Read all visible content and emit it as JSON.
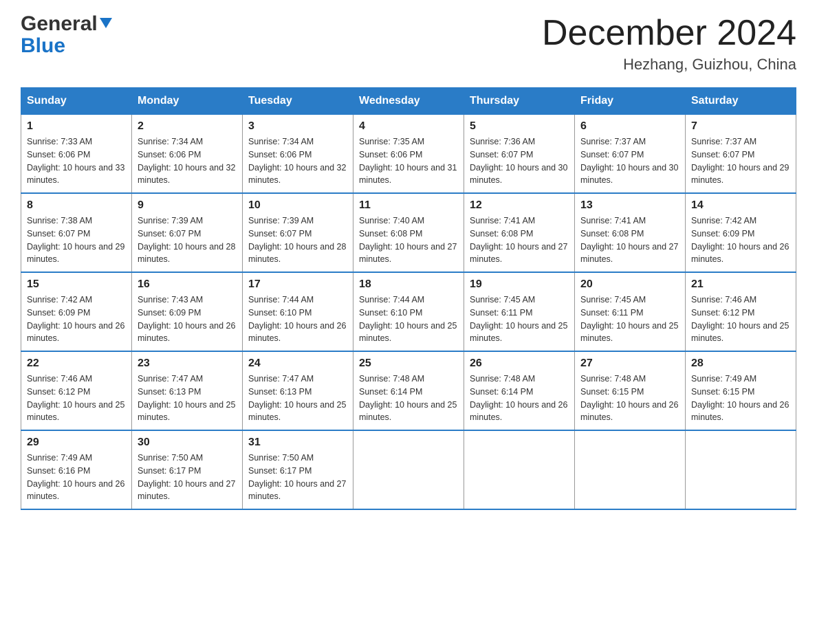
{
  "header": {
    "logo_general": "General",
    "logo_blue": "Blue",
    "month": "December 2024",
    "location": "Hezhang, Guizhou, China"
  },
  "weekdays": [
    "Sunday",
    "Monday",
    "Tuesday",
    "Wednesday",
    "Thursday",
    "Friday",
    "Saturday"
  ],
  "weeks": [
    [
      {
        "day": "1",
        "sunrise": "7:33 AM",
        "sunset": "6:06 PM",
        "daylight": "10 hours and 33 minutes."
      },
      {
        "day": "2",
        "sunrise": "7:34 AM",
        "sunset": "6:06 PM",
        "daylight": "10 hours and 32 minutes."
      },
      {
        "day": "3",
        "sunrise": "7:34 AM",
        "sunset": "6:06 PM",
        "daylight": "10 hours and 32 minutes."
      },
      {
        "day": "4",
        "sunrise": "7:35 AM",
        "sunset": "6:06 PM",
        "daylight": "10 hours and 31 minutes."
      },
      {
        "day": "5",
        "sunrise": "7:36 AM",
        "sunset": "6:07 PM",
        "daylight": "10 hours and 30 minutes."
      },
      {
        "day": "6",
        "sunrise": "7:37 AM",
        "sunset": "6:07 PM",
        "daylight": "10 hours and 30 minutes."
      },
      {
        "day": "7",
        "sunrise": "7:37 AM",
        "sunset": "6:07 PM",
        "daylight": "10 hours and 29 minutes."
      }
    ],
    [
      {
        "day": "8",
        "sunrise": "7:38 AM",
        "sunset": "6:07 PM",
        "daylight": "10 hours and 29 minutes."
      },
      {
        "day": "9",
        "sunrise": "7:39 AM",
        "sunset": "6:07 PM",
        "daylight": "10 hours and 28 minutes."
      },
      {
        "day": "10",
        "sunrise": "7:39 AM",
        "sunset": "6:07 PM",
        "daylight": "10 hours and 28 minutes."
      },
      {
        "day": "11",
        "sunrise": "7:40 AM",
        "sunset": "6:08 PM",
        "daylight": "10 hours and 27 minutes."
      },
      {
        "day": "12",
        "sunrise": "7:41 AM",
        "sunset": "6:08 PM",
        "daylight": "10 hours and 27 minutes."
      },
      {
        "day": "13",
        "sunrise": "7:41 AM",
        "sunset": "6:08 PM",
        "daylight": "10 hours and 27 minutes."
      },
      {
        "day": "14",
        "sunrise": "7:42 AM",
        "sunset": "6:09 PM",
        "daylight": "10 hours and 26 minutes."
      }
    ],
    [
      {
        "day": "15",
        "sunrise": "7:42 AM",
        "sunset": "6:09 PM",
        "daylight": "10 hours and 26 minutes."
      },
      {
        "day": "16",
        "sunrise": "7:43 AM",
        "sunset": "6:09 PM",
        "daylight": "10 hours and 26 minutes."
      },
      {
        "day": "17",
        "sunrise": "7:44 AM",
        "sunset": "6:10 PM",
        "daylight": "10 hours and 26 minutes."
      },
      {
        "day": "18",
        "sunrise": "7:44 AM",
        "sunset": "6:10 PM",
        "daylight": "10 hours and 25 minutes."
      },
      {
        "day": "19",
        "sunrise": "7:45 AM",
        "sunset": "6:11 PM",
        "daylight": "10 hours and 25 minutes."
      },
      {
        "day": "20",
        "sunrise": "7:45 AM",
        "sunset": "6:11 PM",
        "daylight": "10 hours and 25 minutes."
      },
      {
        "day": "21",
        "sunrise": "7:46 AM",
        "sunset": "6:12 PM",
        "daylight": "10 hours and 25 minutes."
      }
    ],
    [
      {
        "day": "22",
        "sunrise": "7:46 AM",
        "sunset": "6:12 PM",
        "daylight": "10 hours and 25 minutes."
      },
      {
        "day": "23",
        "sunrise": "7:47 AM",
        "sunset": "6:13 PM",
        "daylight": "10 hours and 25 minutes."
      },
      {
        "day": "24",
        "sunrise": "7:47 AM",
        "sunset": "6:13 PM",
        "daylight": "10 hours and 25 minutes."
      },
      {
        "day": "25",
        "sunrise": "7:48 AM",
        "sunset": "6:14 PM",
        "daylight": "10 hours and 25 minutes."
      },
      {
        "day": "26",
        "sunrise": "7:48 AM",
        "sunset": "6:14 PM",
        "daylight": "10 hours and 26 minutes."
      },
      {
        "day": "27",
        "sunrise": "7:48 AM",
        "sunset": "6:15 PM",
        "daylight": "10 hours and 26 minutes."
      },
      {
        "day": "28",
        "sunrise": "7:49 AM",
        "sunset": "6:15 PM",
        "daylight": "10 hours and 26 minutes."
      }
    ],
    [
      {
        "day": "29",
        "sunrise": "7:49 AM",
        "sunset": "6:16 PM",
        "daylight": "10 hours and 26 minutes."
      },
      {
        "day": "30",
        "sunrise": "7:50 AM",
        "sunset": "6:17 PM",
        "daylight": "10 hours and 27 minutes."
      },
      {
        "day": "31",
        "sunrise": "7:50 AM",
        "sunset": "6:17 PM",
        "daylight": "10 hours and 27 minutes."
      },
      null,
      null,
      null,
      null
    ]
  ]
}
